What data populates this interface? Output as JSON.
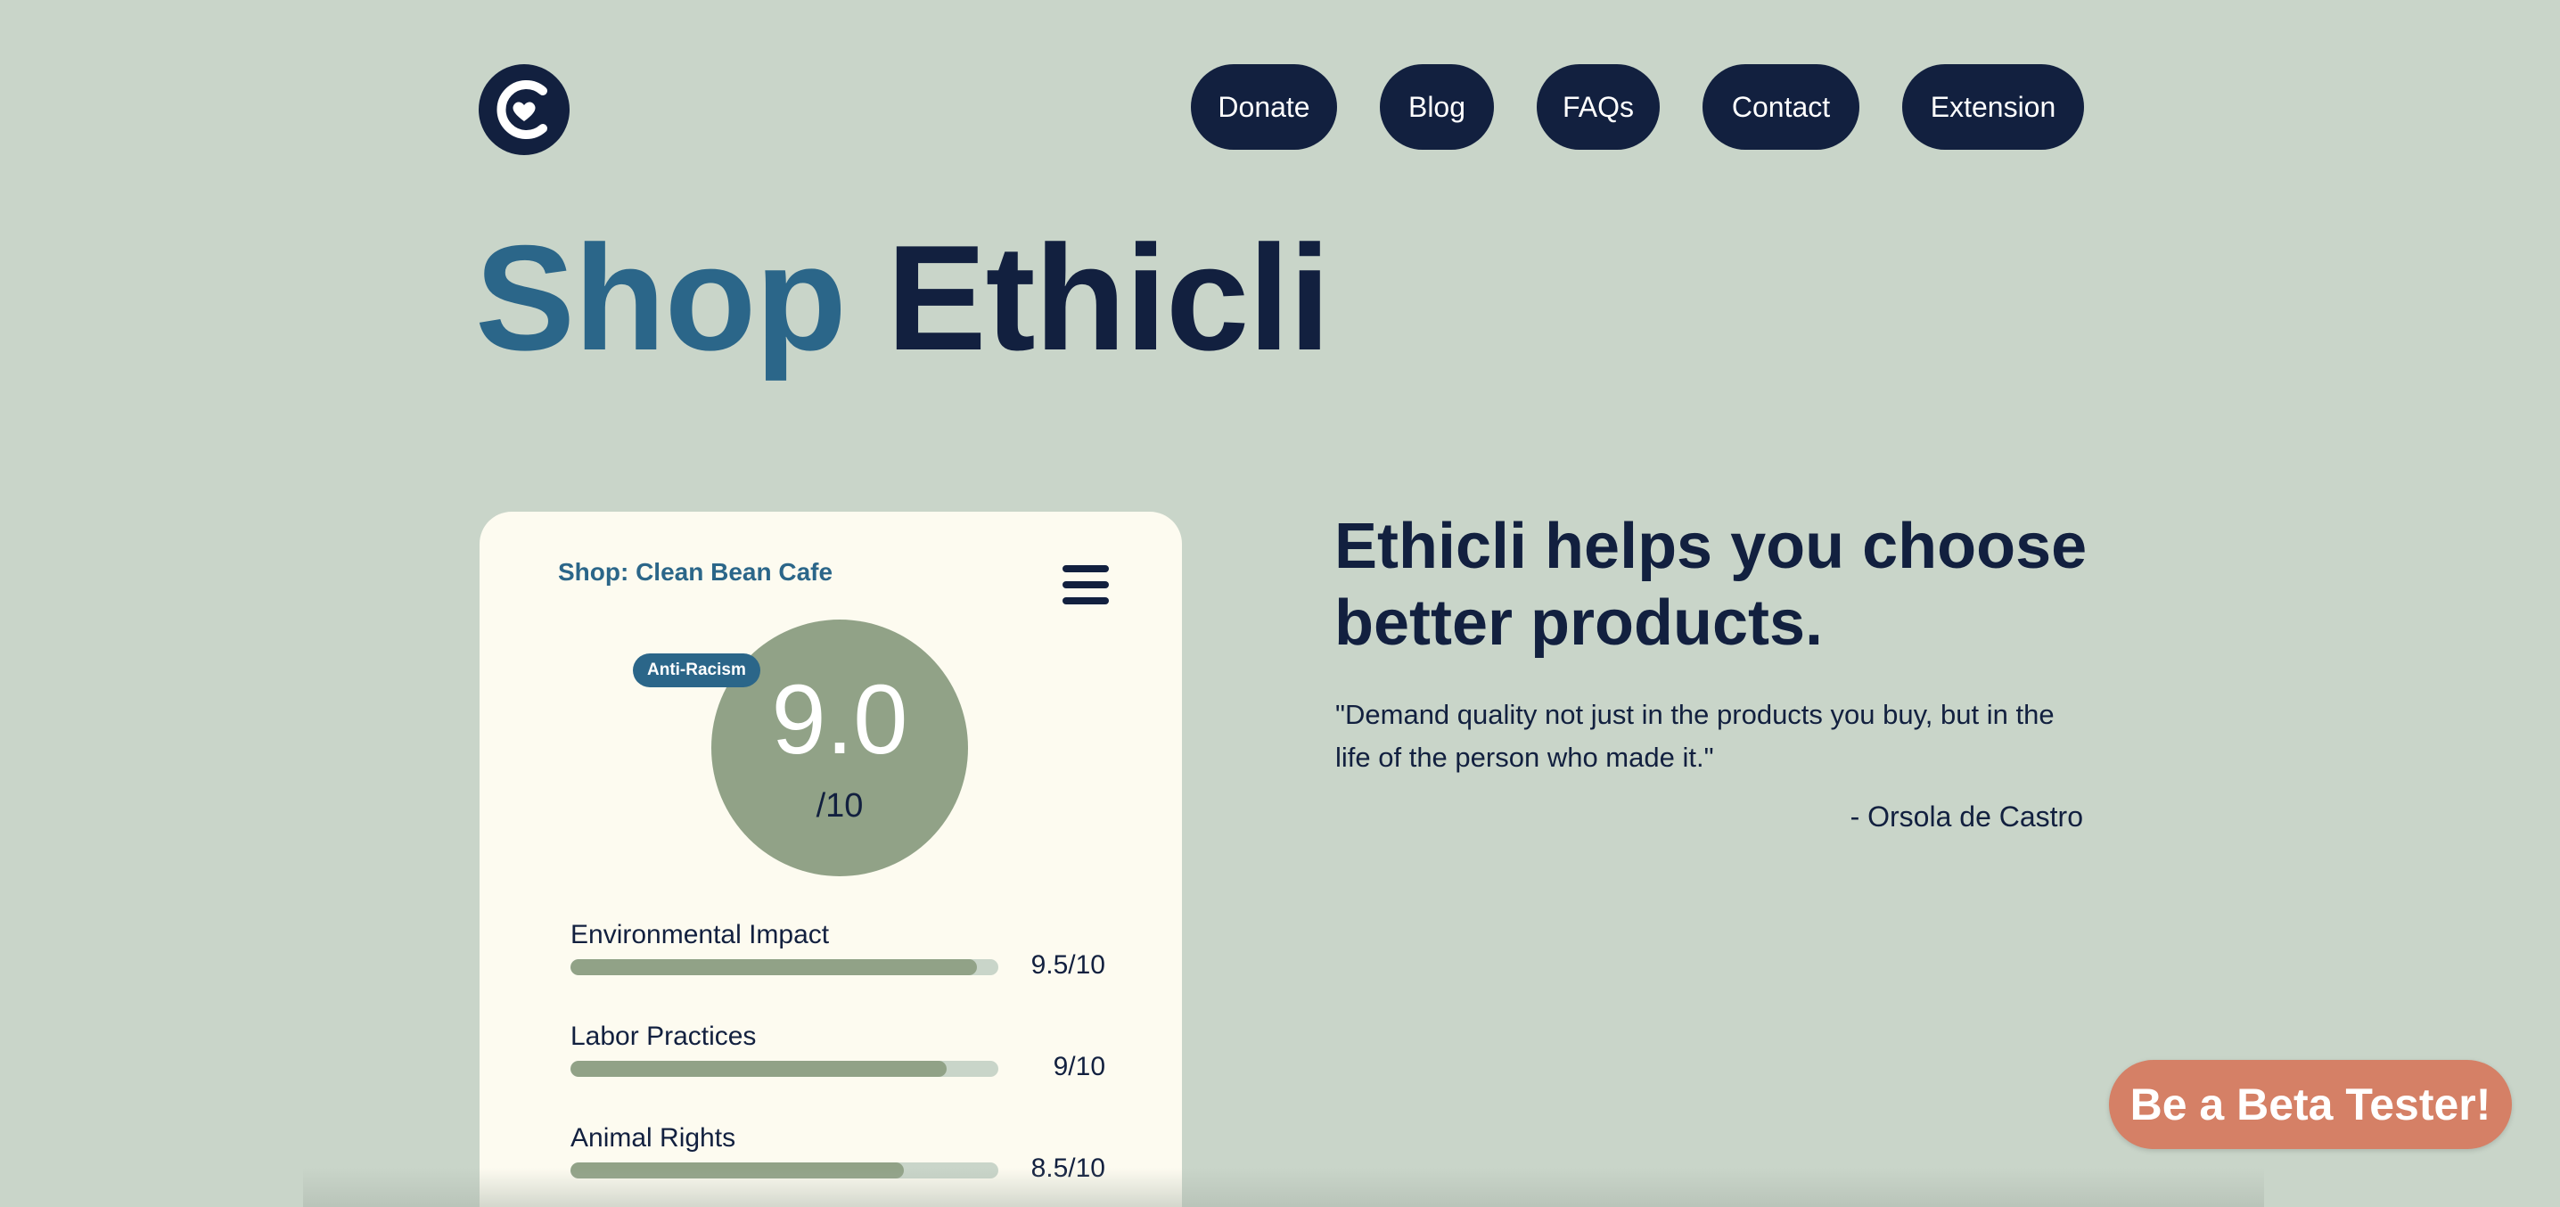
{
  "nav": {
    "logo_icon": "ethicli-logo-icon",
    "items": [
      {
        "label": "Donate"
      },
      {
        "label": "Blog"
      },
      {
        "label": "FAQs"
      },
      {
        "label": "Contact"
      },
      {
        "label": "Extension"
      }
    ]
  },
  "hero": {
    "title_part1": "Shop",
    "title_part2": "Ethicli"
  },
  "card": {
    "shop_label": "Shop: Clean Bean Cafe",
    "menu_icon": "hamburger-menu-icon",
    "tag": "Anti-Racism",
    "score": "9.0",
    "score_denominator": "/10",
    "metrics": [
      {
        "name": "Environmental Impact",
        "score": "9.5/10",
        "fraction": 0.95
      },
      {
        "name": "Labor Practices",
        "score": "9/10",
        "fraction": 0.88
      },
      {
        "name": "Animal Rights",
        "score": "8.5/10",
        "fraction": 0.78
      }
    ]
  },
  "info": {
    "tagline": "Ethicli helps you choose better products.",
    "quote": "\"Demand quality not just in the products you buy, but in the life of the person who made it.\"",
    "author": "- Orsola de Castro"
  },
  "cta": {
    "label": "Be a Beta Tester!"
  },
  "colors": {
    "background": "#c9d5c9",
    "navy": "#12203f",
    "blue": "#2b6689",
    "sage": "#91a287",
    "card": "#fdfbf0",
    "cta": "#d58066"
  }
}
